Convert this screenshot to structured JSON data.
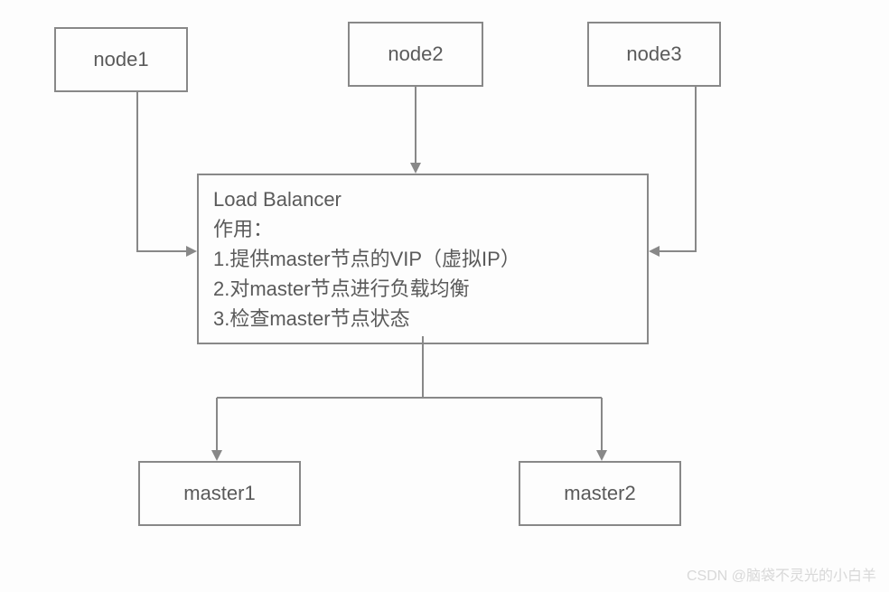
{
  "nodes": {
    "node1": "node1",
    "node2": "node2",
    "node3": "node3"
  },
  "load_balancer": {
    "title": "Load Balancer",
    "role_label": "作用：",
    "items": [
      "1.提供master节点的VIP（虚拟IP）",
      "2.对master节点进行负载均衡",
      "3.检查master节点状态"
    ]
  },
  "masters": {
    "master1": "master1",
    "master2": "master2"
  },
  "watermark": "CSDN @脑袋不灵光的小白羊"
}
